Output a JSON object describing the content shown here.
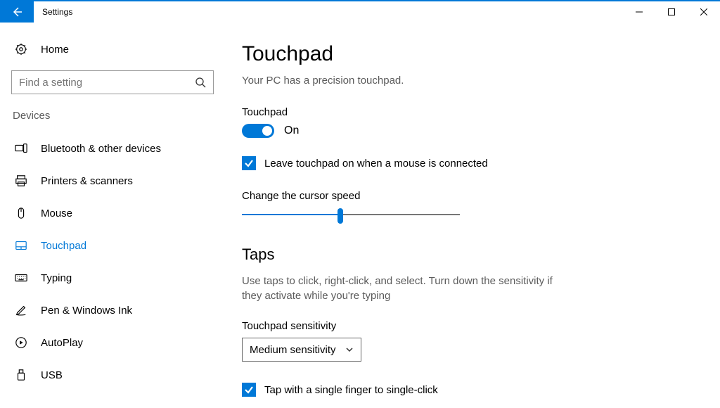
{
  "titlebar": {
    "title": "Settings"
  },
  "sidebar": {
    "home": "Home",
    "search_placeholder": "Find a setting",
    "category": "Devices",
    "items": [
      {
        "label": "Bluetooth & other devices"
      },
      {
        "label": "Printers & scanners"
      },
      {
        "label": "Mouse"
      },
      {
        "label": "Touchpad",
        "active": true
      },
      {
        "label": "Typing"
      },
      {
        "label": "Pen & Windows Ink"
      },
      {
        "label": "AutoPlay"
      },
      {
        "label": "USB"
      }
    ]
  },
  "content": {
    "title": "Touchpad",
    "subtext": "Your PC has a precision touchpad.",
    "touchpad_toggle": {
      "label": "Touchpad",
      "state": "On",
      "value": true
    },
    "leave_on_mouse_label": "Leave touchpad on when a mouse is connected",
    "leave_on_mouse_checked": true,
    "cursor_speed_label": "Change the cursor speed",
    "cursor_speed_value": 5,
    "taps": {
      "heading": "Taps",
      "description": "Use taps to click, right-click, and select. Turn down the sensitivity if they activate while you're typing",
      "sensitivity_label": "Touchpad sensitivity",
      "sensitivity_value": "Medium sensitivity",
      "single_tap_label": "Tap with a single finger to single-click",
      "single_tap_checked": true
    }
  }
}
